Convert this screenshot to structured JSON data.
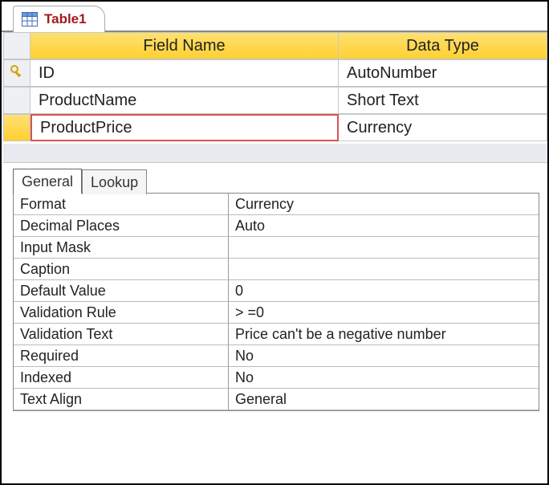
{
  "tab_title": "Table1",
  "columns": {
    "field_name": "Field Name",
    "data_type": "Data Type"
  },
  "fields": [
    {
      "name": "ID",
      "type": "AutoNumber",
      "pk": true,
      "selected": false
    },
    {
      "name": "ProductName",
      "type": "Short Text",
      "pk": false,
      "selected": false
    },
    {
      "name": "ProductPrice",
      "type": "Currency",
      "pk": false,
      "selected": true
    }
  ],
  "prop_tabs": {
    "general": "General",
    "lookup": "Lookup"
  },
  "properties": [
    {
      "label": "Format",
      "value": "Currency"
    },
    {
      "label": "Decimal Places",
      "value": "Auto"
    },
    {
      "label": "Input Mask",
      "value": ""
    },
    {
      "label": "Caption",
      "value": ""
    },
    {
      "label": "Default Value",
      "value": "0"
    },
    {
      "label": "Validation Rule",
      "value": "> =0"
    },
    {
      "label": "Validation Text",
      "value": "Price can't be a negative number"
    },
    {
      "label": "Required",
      "value": "No"
    },
    {
      "label": "Indexed",
      "value": "No"
    },
    {
      "label": "Text Align",
      "value": "General"
    }
  ]
}
